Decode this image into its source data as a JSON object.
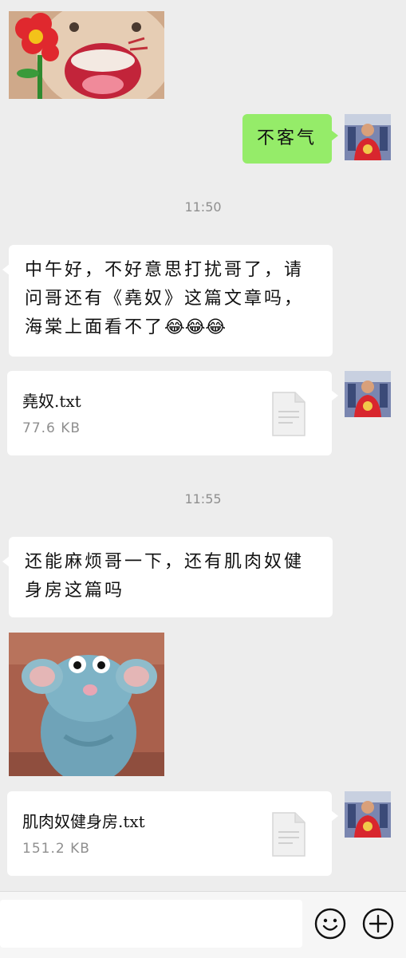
{
  "messages": {
    "reply_thanks": "不客气",
    "time_1": "11:50",
    "request_1_line1": "中午好，不好意思打扰哥了，请",
    "request_1_line2": "问哥还有《堯奴》这篇文章吗，",
    "request_1_line3": "海棠上面看不了",
    "request_1_emoji": "😂😂😂",
    "time_2": "11:55",
    "request_2_line1": "还能麻烦哥一下，还有肌肉奴健",
    "request_2_line2": "身房这篇吗"
  },
  "files": [
    {
      "name": "堯奴.txt",
      "size": "77.6 KB"
    },
    {
      "name": "肌肉奴健身房.txt",
      "size": "151.2 KB"
    }
  ],
  "icons": {
    "file": "document-icon",
    "emoji_button": "smiley-icon",
    "more_button": "plus-circle-icon"
  },
  "colors": {
    "sent_bubble": "#95ec69",
    "received_bubble": "#ffffff",
    "background": "#ededed"
  }
}
